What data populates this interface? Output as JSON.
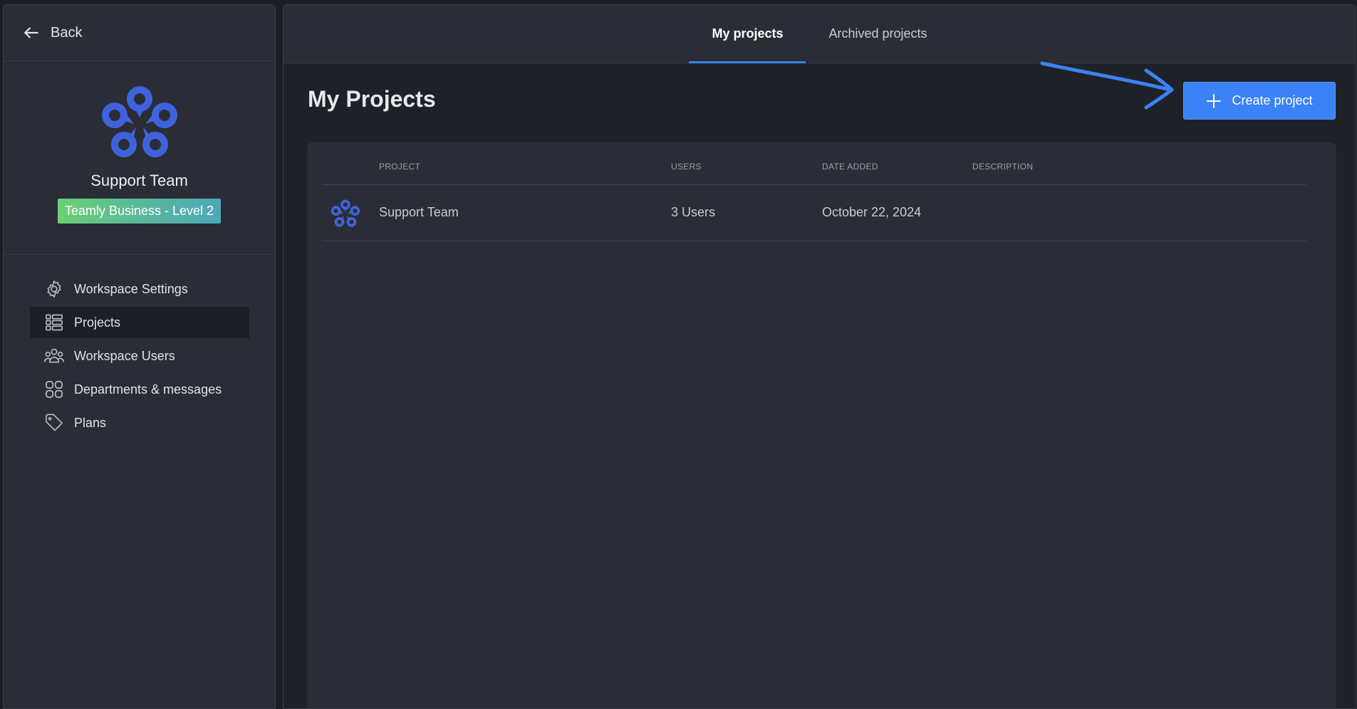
{
  "sidebar": {
    "back_label": "Back",
    "workspace_name": "Support Team",
    "plan_badge": "Teamly Business - Level 2",
    "nav": [
      {
        "label": "Workspace Settings",
        "icon": "gear-icon"
      },
      {
        "label": "Projects",
        "icon": "projects-list-icon",
        "active": true
      },
      {
        "label": "Workspace Users",
        "icon": "users-icon"
      },
      {
        "label": "Departments & messages",
        "icon": "grid-icon"
      },
      {
        "label": "Plans",
        "icon": "tag-icon"
      }
    ]
  },
  "tabs": [
    {
      "label": "My projects",
      "active": true
    },
    {
      "label": "Archived projects",
      "active": false
    }
  ],
  "page": {
    "title": "My Projects",
    "create_label": "Create project"
  },
  "table": {
    "columns": [
      "PROJECT",
      "USERS",
      "DATE ADDED",
      "DESCRIPTION"
    ],
    "rows": [
      {
        "project": "Support Team",
        "users": "3 Users",
        "date_added": "October 22, 2024",
        "description": ""
      }
    ]
  },
  "colors": {
    "accent": "#3b82f6",
    "logo": "#3f63dd",
    "badge_from": "#6ccf74",
    "badge_to": "#4ea9b8"
  }
}
